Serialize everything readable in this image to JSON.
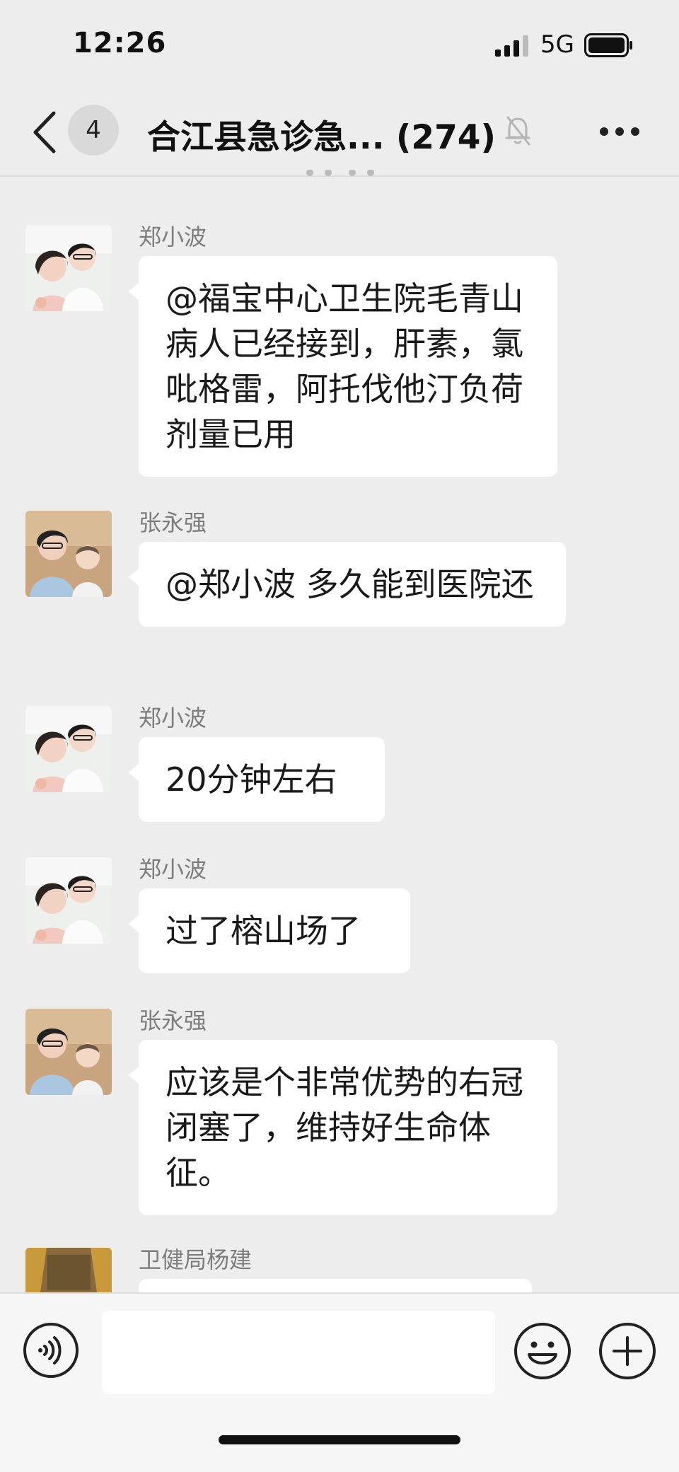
{
  "status_bar": {
    "time": "12:26",
    "network": "5G"
  },
  "header": {
    "unread_badge": "4",
    "title": "合江县急诊急... (274)"
  },
  "messages": [
    {
      "sender": "郑小波",
      "avatar": "couple-avatar",
      "text": "@福宝中心卫生院毛青山 病人已经接到，肝素，氯吡格雷，阿托伐他汀负荷剂量已用"
    },
    {
      "sender": "张永强",
      "avatar": "father-child-avatar",
      "text": "@郑小波 多久能到医院还"
    },
    {
      "sender": "郑小波",
      "avatar": "couple-avatar",
      "text": "20分钟左右"
    },
    {
      "sender": "郑小波",
      "avatar": "couple-avatar",
      "text": "过了榕山场了"
    },
    {
      "sender": "张永强",
      "avatar": "father-child-avatar",
      "text": "应该是个非常优势的右冠闭塞了，维持好生命体征。"
    },
    {
      "sender": "卫健局杨建",
      "avatar": "group-photo-avatar",
      "text": ""
    }
  ],
  "input": {
    "placeholder": ""
  },
  "colors": {
    "background": "#ededed",
    "bubble": "#ffffff",
    "sender_name": "#7d7d7d"
  }
}
